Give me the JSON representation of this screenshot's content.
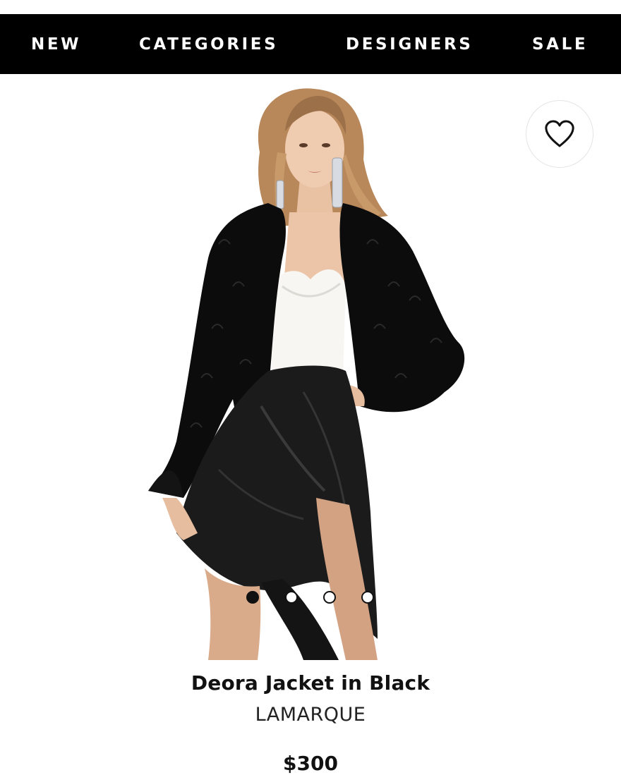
{
  "nav": {
    "items": [
      {
        "label": "NEW"
      },
      {
        "label": "CATEGORIES"
      },
      {
        "label": "DESIGNERS"
      },
      {
        "label": "SALE"
      }
    ]
  },
  "wishlist": {
    "icon": "heart-outline-icon"
  },
  "carousel": {
    "slide_count": 4,
    "active_index": 0
  },
  "product": {
    "name": "Deora Jacket in Black",
    "brand": "LAMARQUE",
    "price": "$300"
  },
  "colors": {
    "nav_background": "#000000",
    "nav_text": "#ffffff",
    "text": "#111111"
  }
}
